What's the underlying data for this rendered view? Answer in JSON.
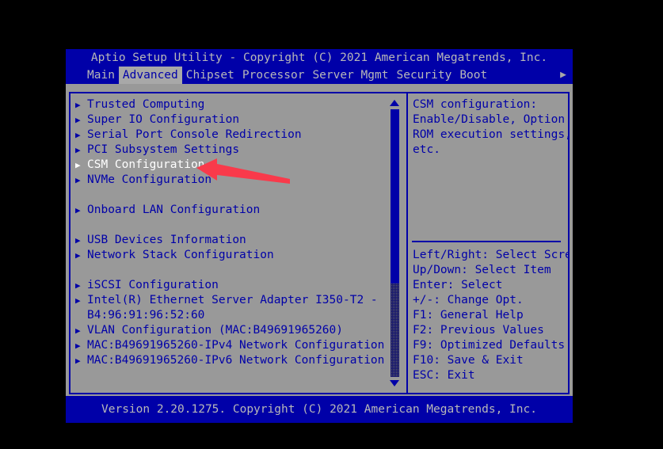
{
  "window": {
    "title": "Aptio Setup Utility - Copyright (C) 2021 American Megatrends, Inc.",
    "footer": "Version 2.20.1275. Copyright (C) 2021 American Megatrends, Inc."
  },
  "tabs": [
    {
      "label": "Main",
      "active": false
    },
    {
      "label": "Advanced",
      "active": true
    },
    {
      "label": "Chipset",
      "active": false
    },
    {
      "label": "Processor",
      "active": false
    },
    {
      "label": "Server Mgmt",
      "active": false
    },
    {
      "label": "Security",
      "active": false
    },
    {
      "label": "Boot",
      "active": false
    }
  ],
  "tab_more_icon": "triangle-right-icon",
  "menu": {
    "items": [
      {
        "label": "Trusted Computing",
        "type": "submenu",
        "selected": false
      },
      {
        "label": "Super IO Configuration",
        "type": "submenu",
        "selected": false
      },
      {
        "label": "Serial Port Console Redirection",
        "type": "submenu",
        "selected": false
      },
      {
        "label": "PCI Subsystem Settings",
        "type": "submenu",
        "selected": false
      },
      {
        "label": "CSM Configuration",
        "type": "submenu",
        "selected": true
      },
      {
        "label": "NVMe Configuration",
        "type": "submenu",
        "selected": false
      },
      {
        "label": "",
        "type": "spacer",
        "selected": false
      },
      {
        "label": "Onboard LAN Configuration",
        "type": "submenu",
        "selected": false
      },
      {
        "label": "",
        "type": "spacer",
        "selected": false
      },
      {
        "label": "USB Devices Information",
        "type": "submenu",
        "selected": false
      },
      {
        "label": "Network Stack Configuration",
        "type": "submenu",
        "selected": false
      },
      {
        "label": "",
        "type": "spacer",
        "selected": false
      },
      {
        "label": "iSCSI Configuration",
        "type": "submenu",
        "selected": false
      },
      {
        "label": "Intel(R) Ethernet Server Adapter I350-T2 -",
        "type": "submenu",
        "selected": false
      },
      {
        "label": "B4:96:91:96:52:60",
        "type": "continuation",
        "selected": false
      },
      {
        "label": "VLAN Configuration (MAC:B49691965260)",
        "type": "submenu",
        "selected": false
      },
      {
        "label": "MAC:B49691965260-IPv4 Network Configuration",
        "type": "submenu",
        "selected": false
      },
      {
        "label": "MAC:B49691965260-IPv6 Network Configuration",
        "type": "submenu",
        "selected": false
      }
    ]
  },
  "scrollbar": {
    "up_arrow_icon": "triangle-up-icon",
    "down_arrow_icon": "triangle-down-icon"
  },
  "help": {
    "description": [
      "CSM configuration:",
      "Enable/Disable, Option",
      "ROM execution settings,",
      "etc."
    ],
    "keys": [
      "Left/Right: Select Screen",
      "Up/Down: Select Item",
      "Enter: Select",
      "+/-: Change Opt.",
      "F1: General Help",
      "F2: Previous Values",
      "F9: Optimized Defaults",
      "F10: Save & Exit",
      "ESC: Exit"
    ]
  },
  "annotation": {
    "type": "arrow",
    "direction": "left",
    "color": "#F93A4B",
    "points_to": "CSM Configuration"
  },
  "colors": {
    "bios_blue": "#0000A8",
    "body_gray": "#999999",
    "tab_active_bg": "#a8a8a8",
    "text_light": "#b8b8b8",
    "selected_text": "#ffffff",
    "screen_black": "#000000"
  }
}
